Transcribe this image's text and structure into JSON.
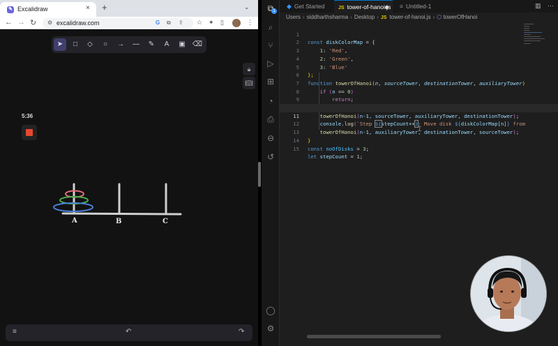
{
  "browser": {
    "tab_title": "Excalidraw",
    "tab_close": "×",
    "new_tab": "+",
    "tab_menu": "⌄",
    "back": "←",
    "forward": "→",
    "reload": "↻",
    "url": "excalidraw.com"
  },
  "excalidraw": {
    "tools": [
      "pointer",
      "rectangle",
      "diamond",
      "ellipse",
      "arrow",
      "line",
      "draw",
      "text",
      "image",
      "eraser"
    ],
    "timer": "5:36",
    "peg_labels": [
      "A",
      "B",
      "C"
    ],
    "disk_colors": [
      "#e06c75",
      "#4caf50",
      "#4a7fd6"
    ],
    "bottom_menu": "≡",
    "undo": "↶",
    "redo": "↷"
  },
  "vscode": {
    "tabs": [
      {
        "label": "Get Started"
      },
      {
        "label": "tower-of-hanoi.js"
      },
      {
        "label": "Untitled-1"
      }
    ],
    "breadcrumb": [
      "Users",
      "siddharthsharma",
      "Desktop",
      "tower-of-hanoi.js",
      "towerOfHanoi"
    ],
    "line_numbers": [
      "1",
      "2",
      "3",
      "4",
      "5",
      "6",
      "7",
      "8",
      "9",
      "10",
      "11",
      "12",
      "13",
      "14",
      "15"
    ],
    "current_line": 11,
    "code": {
      "l1_const": "const",
      "l1_name": "diskColorMap",
      "l1_rest": " = {",
      "l2_key": "1",
      "l2_val": "'Red'",
      "l3_key": "2",
      "l3_val": "'Green'",
      "l4_key": "3",
      "l4_val": "'Blue'",
      "l5": "};",
      "l6_kw": "function",
      "l6_name": "towerOfHanoi",
      "l6_p1": "n",
      "l6_p2": "sourceTower",
      "l6_p3": "destinationTower",
      "l6_p4": "auxiliaryTower",
      "l7_kw": "if",
      "l7_var": "n",
      "l7_op": " == ",
      "l7_num": "0",
      "l8_kw": "return",
      "l10_fn": "towerOfHanoi",
      "l10_args": "n-1, sourceTower, auxiliaryTower, destinationTower",
      "l11_obj": "console",
      "l11_fn": "log",
      "l11_tpl_a": "`Step ",
      "l11_var1": "stepCount++",
      "l11_tpl_b": ": Move disk ",
      "l11_var2": "diskColorMap[n]",
      "l11_tpl_c": " from",
      "l12_fn": "towerOfHanoi",
      "l12_args": "n-1, auxiliaryTower, destinationTower, sourceTower",
      "l13": "}",
      "l14_kw": "const",
      "l14_name": "noOfDisks",
      "l14_num": "3",
      "l15_kw": "let",
      "l15_name": "stepCount",
      "l15_num": "1"
    }
  }
}
